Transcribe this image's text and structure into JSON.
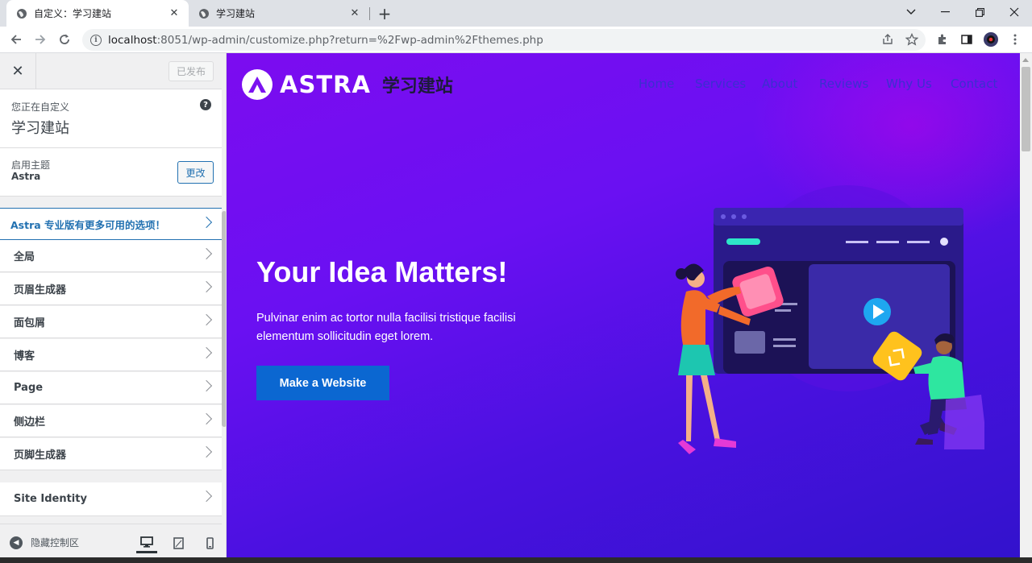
{
  "browser": {
    "tabs": [
      {
        "title": "自定义：学习建站",
        "active": true
      },
      {
        "title": "学习建站",
        "active": false
      }
    ],
    "url_host": "localhost",
    "url_rest": ":8051/wp-admin/customize.php?return=%2Fwp-admin%2Fthemes.php"
  },
  "customizer": {
    "publish_label": "已发布",
    "customizing_label": "您正在自定义",
    "site_title": "学习建站",
    "active_theme_label": "启用主题",
    "theme_name": "Astra",
    "change_label": "更改",
    "promo": "Astra 专业版有更多可用的选项！",
    "sections": [
      "全局",
      "页眉生成器",
      "面包屑",
      "博客",
      "Page",
      "侧边栏",
      "页脚生成器"
    ],
    "site_identity": "Site Identity",
    "hide_controls": "隐藏控制区"
  },
  "preview": {
    "logo_text": "ASTRA",
    "site_name": "学习建站",
    "menu": [
      "Home",
      "Services",
      "About",
      "Reviews",
      "Why Us",
      "Contact"
    ],
    "hero_title": "Your Idea Matters!",
    "hero_text": "Pulvinar enim ac tortor nulla facilisi tristique facilisi elementum sollicitudin eget lorem.",
    "hero_button": "Make a Website"
  },
  "colors": {
    "accent": "#2271b1",
    "hero_button": "#0b67d1",
    "hero_bg": "#6a10f2"
  }
}
